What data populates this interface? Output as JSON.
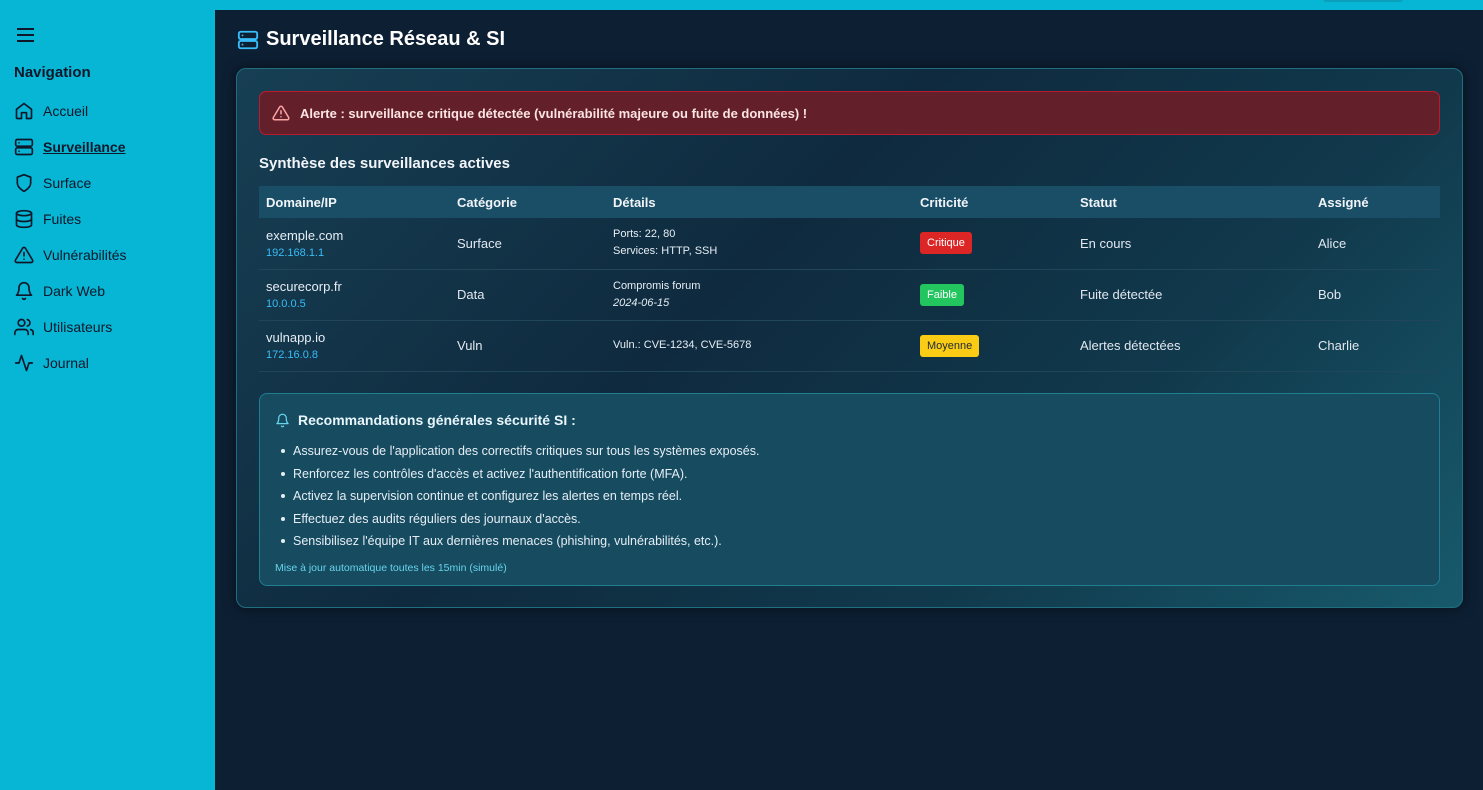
{
  "sidebar": {
    "heading": "Navigation",
    "items": [
      {
        "label": "Accueil",
        "icon": "home-icon"
      },
      {
        "label": "Surveillance",
        "icon": "server-icon",
        "active": true
      },
      {
        "label": "Surface",
        "icon": "shield-icon"
      },
      {
        "label": "Fuites",
        "icon": "database-icon"
      },
      {
        "label": "Vulnérabilités",
        "icon": "warning-icon"
      },
      {
        "label": "Dark Web",
        "icon": "bell-icon"
      },
      {
        "label": "Utilisateurs",
        "icon": "users-icon"
      },
      {
        "label": "Journal",
        "icon": "activity-icon"
      }
    ]
  },
  "page": {
    "title": "Surveillance Réseau & SI"
  },
  "alert": {
    "text": "Alerte : surveillance critique détectée (vulnérabilité majeure ou fuite de données) !"
  },
  "summary": {
    "title": "Synthèse des surveillances actives",
    "columns": [
      "Domaine/IP",
      "Catégorie",
      "Détails",
      "Criticité",
      "Statut",
      "Assigné"
    ],
    "rows": [
      {
        "domain": "exemple.com",
        "ip": "192.168.1.1",
        "category": "Surface",
        "details": [
          "Ports: 22, 80",
          "Services: HTTP, SSH"
        ],
        "criticity": "Critique",
        "status": "En cours",
        "assignee": "Alice"
      },
      {
        "domain": "securecorp.fr",
        "ip": "10.0.0.5",
        "category": "Data",
        "details": [
          "Compromis forum",
          "2024-06-15"
        ],
        "criticity": "Faible",
        "status": "Fuite détectée",
        "assignee": "Bob"
      },
      {
        "domain": "vulnapp.io",
        "ip": "172.16.0.8",
        "category": "Vuln",
        "details": [
          "Vuln.: CVE-1234, CVE-5678"
        ],
        "criticity": "Moyenne",
        "status": "Alertes détectées",
        "assignee": "Charlie"
      }
    ]
  },
  "recommendations": {
    "title": "Recommandations générales sécurité SI :",
    "items": [
      "Assurez-vous de l'application des correctifs critiques sur tous les systèmes exposés.",
      "Renforcez les contrôles d'accès et activez l'authentification forte (MFA).",
      "Activez la supervision continue et configurez les alertes en temps réel.",
      "Effectuez des audits réguliers des journaux d'accès.",
      "Sensibilisez l'équipe IT aux dernières menaces (phishing, vulnérabilités, etc.)."
    ],
    "note": "Mise à jour automatique toutes les 15min (simulé)"
  },
  "colors": {
    "sidebar": "#06b6d4",
    "background": "#0d1f33",
    "critique": "#dc2626",
    "faible": "#22c55e",
    "moyenne": "#facc15",
    "ip_link": "#38bdf8"
  }
}
